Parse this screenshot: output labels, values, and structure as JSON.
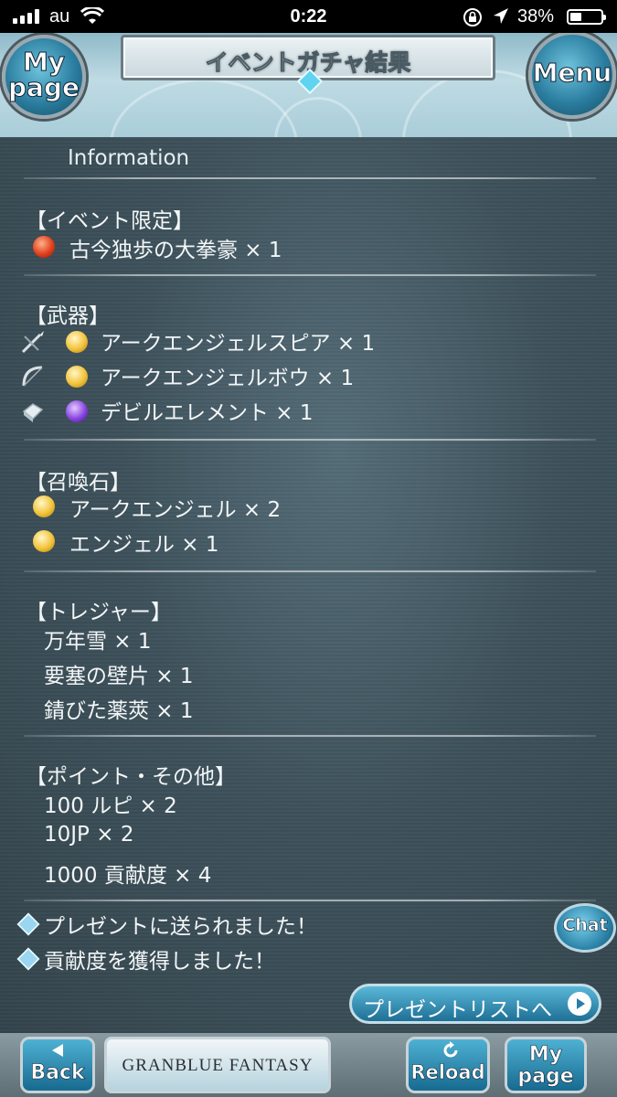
{
  "status_bar": {
    "carrier": "au",
    "time": "0:22",
    "battery": "38%"
  },
  "header": {
    "title": "イベントガチャ結果",
    "left_button": [
      "My",
      "page"
    ],
    "right_button": "Menu"
  },
  "info_heading": "Information",
  "sections": {
    "event": {
      "title": "【イベント限定】",
      "items": [
        "古今独歩の大拳豪 × 1"
      ]
    },
    "weapons": {
      "title": "【武器】",
      "items": [
        "アークエンジェルスピア × 1",
        "アークエンジェルボウ × 1",
        "デビルエレメント × 1"
      ]
    },
    "summons": {
      "title": "【召喚石】",
      "items": [
        "アークエンジェル × 2",
        "エンジェル × 1"
      ]
    },
    "treasure": {
      "title": "【トレジャー】",
      "items": [
        "万年雪 × 1",
        "要塞の壁片 × 1",
        "錆びた薬莢 × 1"
      ]
    },
    "points": {
      "title": "【ポイント・その他】",
      "items": [
        "100 ルピ × 2",
        "10JP × 2",
        "1000 貢献度 × 4"
      ]
    }
  },
  "notices": [
    "プレゼントに送られました！",
    "貢献度を獲得しました！"
  ],
  "chat_label": "Chat",
  "present_button": "プレゼントリストへ",
  "bottom_bar": {
    "back": "Back",
    "logo": "GRANBLUE FANTASY",
    "reload": "Reload",
    "mypage": [
      "My",
      "page"
    ]
  }
}
